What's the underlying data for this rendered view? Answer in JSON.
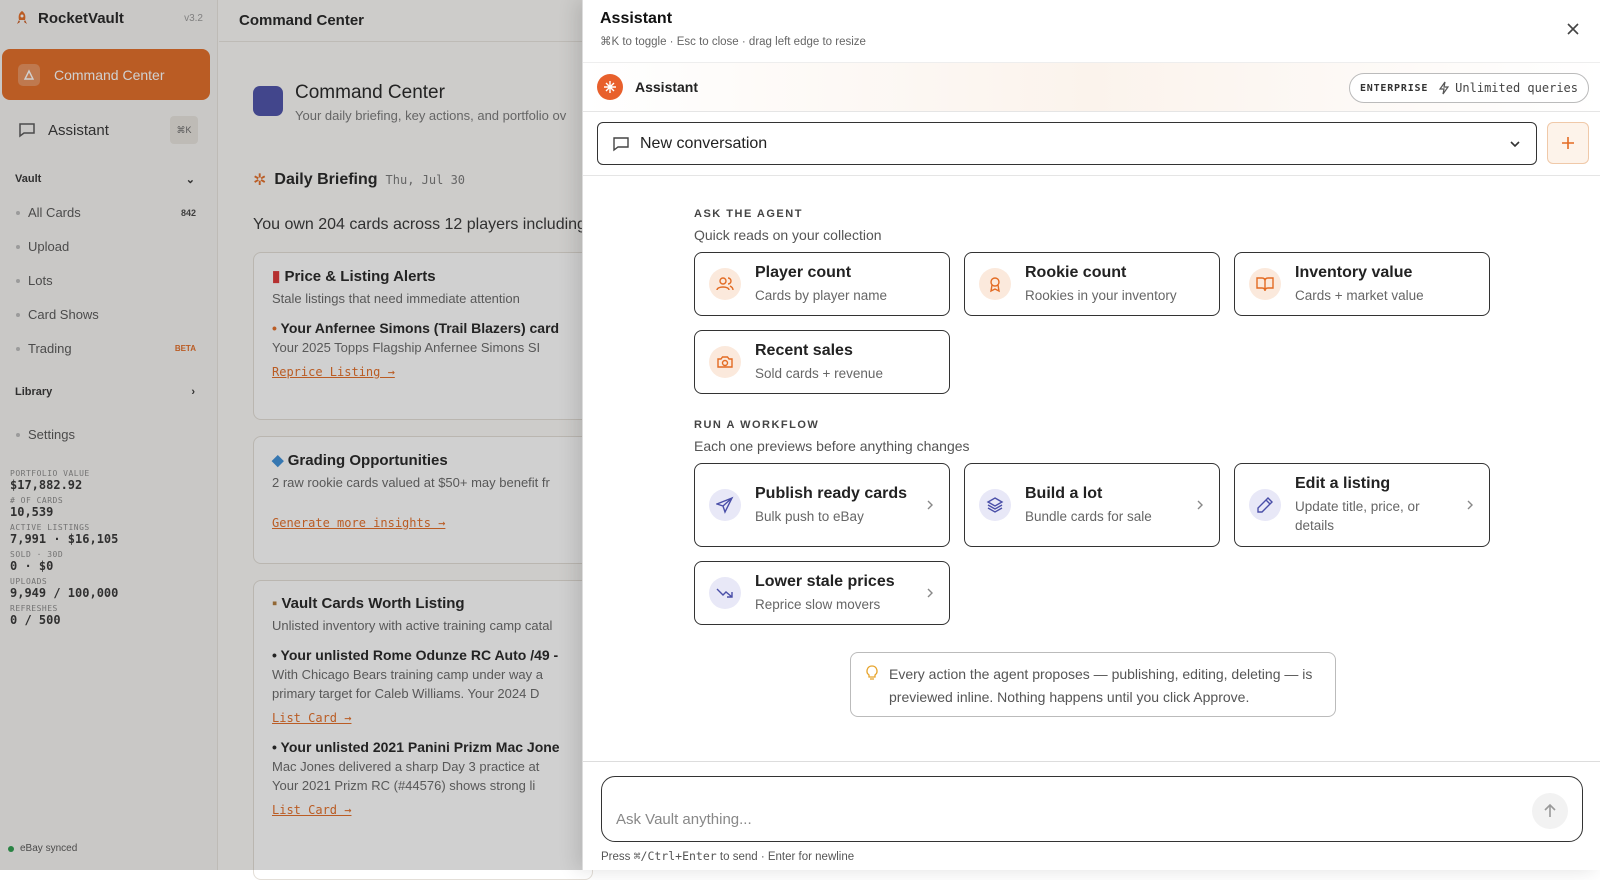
{
  "app": {
    "brand": "RocketVault",
    "version": "v3.2",
    "topbar_title": "Command Center",
    "sidebar": {
      "active_item": "Command Center",
      "assistant_label": "Assistant",
      "assistant_shortcut": "⌘K",
      "vault_label": "Vault",
      "vault_items": [
        {
          "label": "All Cards",
          "badge": "842"
        },
        {
          "label": "Upload",
          "badge": ""
        },
        {
          "label": "Lots",
          "badge": ""
        },
        {
          "label": "Card Shows",
          "badge": ""
        },
        {
          "label": "Trading",
          "badge": "BETA"
        }
      ],
      "library_label": "Library",
      "settings_label": "Settings",
      "stats": [
        {
          "label": "PORTFOLIO VALUE",
          "value": "$17,882.92"
        },
        {
          "label": "# OF CARDS",
          "value": "10,539"
        },
        {
          "label": "ACTIVE LISTINGS",
          "value": "7,991 · $16,105"
        },
        {
          "label": "SOLD · 30D",
          "value": "0 · $0"
        },
        {
          "label": "UPLOADS",
          "value": "9,949 / 100,000"
        },
        {
          "label": "REFRESHES",
          "value": "0 / 500"
        }
      ],
      "sync_status": "eBay synced"
    },
    "main": {
      "title": "Command Center",
      "subtitle": "Your daily briefing, key actions, and portfolio ov",
      "briefing_title": "Daily Briefing",
      "briefing_date": "Thu, Jul 30",
      "summary": "You own 204 cards across 12 players including",
      "cards": [
        {
          "title": "Price & Listing Alerts",
          "subtitle": "Stale listings that need immediate attention",
          "item_title": "Your Anfernee Simons (Trail Blazers) card",
          "item_desc": "Your 2025 Topps Flagship Anfernee Simons SI",
          "link": "Reprice Listing →"
        },
        {
          "title": "Grading Opportunities",
          "subtitle": "2 raw rookie cards valued at $50+ may benefit fr",
          "link": "Generate more insights →"
        },
        {
          "title": "Vault Cards Worth Listing",
          "subtitle": "Unlisted inventory with active training camp catal",
          "item_title": "Your unlisted Rome Odunze RC Auto /49 -",
          "item_desc": "With Chicago Bears training camp under way a",
          "item_desc2": "primary target for Caleb Williams. Your 2024 D",
          "link": "List Card →",
          "item2_title": "Your unlisted 2021 Panini Prizm Mac Jone",
          "item2_desc": "Mac Jones delivered a sharp Day 3 practice at",
          "item2_desc2": "Your 2021 Prizm RC (#44576) shows strong li",
          "link2": "List Card →"
        }
      ]
    }
  },
  "panel": {
    "title": "Assistant",
    "hint": "⌘K to toggle · Esc to close · drag left edge to resize",
    "agent_name": "Assistant",
    "plan_badge": "ENTERPRISE",
    "plan_quota": "Unlimited queries",
    "conversation": "New conversation",
    "ask_section": {
      "label": "ASK THE AGENT",
      "subtitle": "Quick reads on your collection",
      "options": [
        {
          "title": "Player count",
          "subtitle": "Cards by player name",
          "icon": "users-icon"
        },
        {
          "title": "Rookie count",
          "subtitle": "Rookies in your inventory",
          "icon": "award-icon"
        },
        {
          "title": "Inventory value",
          "subtitle": "Cards + market value",
          "icon": "book-open-icon"
        },
        {
          "title": "Recent sales",
          "subtitle": "Sold cards + revenue",
          "icon": "camera-icon"
        }
      ]
    },
    "workflow_section": {
      "label": "RUN A WORKFLOW",
      "subtitle": "Each one previews before anything changes",
      "options": [
        {
          "title": "Publish ready cards",
          "subtitle": "Bulk push to eBay",
          "icon": "send-icon"
        },
        {
          "title": "Build a lot",
          "subtitle": "Bundle cards for sale",
          "icon": "layers-icon"
        },
        {
          "title": "Edit a listing",
          "subtitle": "Update title, price, or details",
          "icon": "pencil-icon"
        },
        {
          "title": "Lower stale prices",
          "subtitle": "Reprice slow movers",
          "icon": "trending-down-icon"
        }
      ]
    },
    "note": "Every action the agent proposes — publishing, editing, deleting — is previewed inline. Nothing happens until you click Approve.",
    "input": {
      "placeholder": "Ask Vault anything...",
      "value": ""
    },
    "footer": {
      "prefix": "Press",
      "keys": "⌘/Ctrl+Enter",
      "suffix": "to send · Enter for newline"
    },
    "colors": {
      "accent": "#e36b23",
      "workflow_icon_bg": "#e8e8f7",
      "ask_icon_bg": "#fbe9dc"
    }
  }
}
